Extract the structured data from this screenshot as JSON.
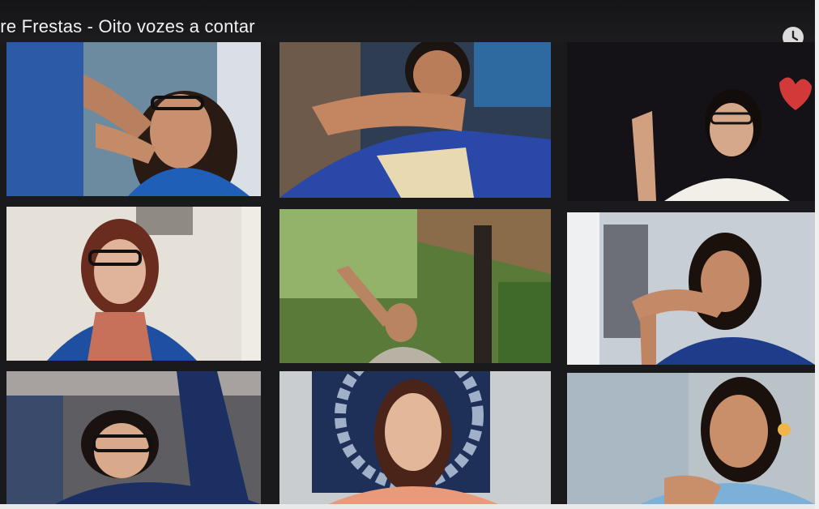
{
  "meeting": {
    "title": "tre Frestas - Oito vozes a contar"
  },
  "controls": {
    "clock_icon": "clock-icon"
  },
  "participants": [
    {
      "tile": "participant-tile-1",
      "bg": "#5f7f96",
      "shirt": "#1f5fb7",
      "hair": "#2a1a14",
      "skin": "#c9906f"
    },
    {
      "tile": "participant-tile-2",
      "bg": "#3a4a5c",
      "shirt": "#2a48a8",
      "hair": "#1c1410",
      "skin": "#b97d5a"
    },
    {
      "tile": "participant-tile-3",
      "bg": "#161418",
      "shirt": "#f2efe8",
      "hair": "#120c0a",
      "skin": "#d6a88a"
    },
    {
      "tile": "participant-tile-4",
      "bg": "#e6e1d8",
      "shirt": "#1e4fa0",
      "hair": "#6a2c1e",
      "skin": "#e0b49a"
    },
    {
      "tile": "participant-tile-5",
      "bg": "#5a7a3a",
      "shirt": "#b8b2a4",
      "hair": "#1a1410",
      "skin": "#b88462"
    },
    {
      "tile": "participant-tile-6",
      "bg": "#c7ced6",
      "shirt": "#1f3c8a",
      "hair": "#1a100c",
      "skin": "#c48a68"
    },
    {
      "tile": "participant-tile-7",
      "bg": "#6a6a6a",
      "shirt": "#1c2f63",
      "hair": "#1a1210",
      "skin": "#d8a98b"
    },
    {
      "tile": "participant-tile-8",
      "bg": "#c9cdd0",
      "shirt": "#e89a7a",
      "hair": "#4a2418",
      "skin": "#e2b79a"
    },
    {
      "tile": "participant-tile-9",
      "bg": "#a9b8c2",
      "shirt": "#7db0d8",
      "hair": "#1a100c",
      "skin": "#c98e6a"
    }
  ]
}
